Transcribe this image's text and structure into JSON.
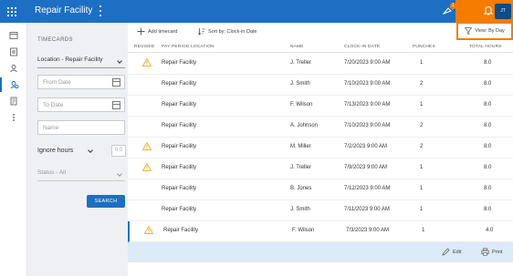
{
  "header": {
    "app_title": "Repair Facility",
    "feature_badge_count": "1",
    "help_label": "?",
    "notification_count": "0",
    "avatar_initials": "JT"
  },
  "filters": {
    "section_title": "TIMECARDS",
    "location_value": "Location - Repair Facility",
    "from_date_placeholder": "From Date",
    "to_date_placeholder": "To Date",
    "name_placeholder": "Name",
    "ignore_hours_label": "Ignore hours",
    "ignore_hours_value": "0.0",
    "status_value": "Status - All",
    "search_label": "SEARCH"
  },
  "toolbar": {
    "add_label": "Add timecard",
    "sort_label": "Sort by: Clock-in Date",
    "view_label": "View: By Day"
  },
  "table": {
    "columns": [
      "REVISED",
      "PAY PERIOD LOCATION",
      "NAME",
      "CLOCK-IN DATE",
      "PUNCHES",
      "TOTAL HOURS"
    ],
    "rows": [
      {
        "revised": true,
        "location": "Repair Facility",
        "name": "J. Treller",
        "date": "7/20/2023 9:00 AM",
        "punches": "1",
        "hours": "8.0"
      },
      {
        "revised": false,
        "location": "Repair Facility",
        "name": "J. Smith",
        "date": "7/10/2023 9:00 AM",
        "punches": "2",
        "hours": "8.0"
      },
      {
        "revised": false,
        "location": "Repair Facility",
        "name": "F. Wilson",
        "date": "7/13/2023 9:00 AM",
        "punches": "1",
        "hours": "8.0"
      },
      {
        "revised": false,
        "location": "Repair Facility",
        "name": "A. Johnson",
        "date": "7/10/2023 9:00 AM",
        "punches": "2",
        "hours": "8.0"
      },
      {
        "revised": true,
        "location": "Repair Facility",
        "name": "M. Miller",
        "date": "7/2/2023 9:00 AM",
        "punches": "2",
        "hours": "8.0"
      },
      {
        "revised": true,
        "location": "Repair Facility",
        "name": "J. Treller",
        "date": "7/9/2023 9:00 AM",
        "punches": "1",
        "hours": "8.0"
      },
      {
        "revised": false,
        "location": "Repair Facility",
        "name": "B. Jones",
        "date": "7/12/2023 9:00 AM",
        "punches": "1",
        "hours": "8.0"
      },
      {
        "revised": false,
        "location": "Repair Facility",
        "name": "J. Smith",
        "date": "7/11/2023 9:00 AM",
        "punches": "1",
        "hours": "8.0"
      },
      {
        "revised": true,
        "location": "Repair Facility",
        "name": "F. Wilson",
        "date": "7/3/2023 9:00 AM",
        "punches": "1",
        "hours": "4.0"
      }
    ]
  },
  "footer": {
    "edit_label": "Edit",
    "print_label": "Print"
  },
  "colors": {
    "primary": "#1d6fc4",
    "highlight": "#f57c00",
    "warning": "#f5a623",
    "selected_row": "#dce9f7"
  }
}
